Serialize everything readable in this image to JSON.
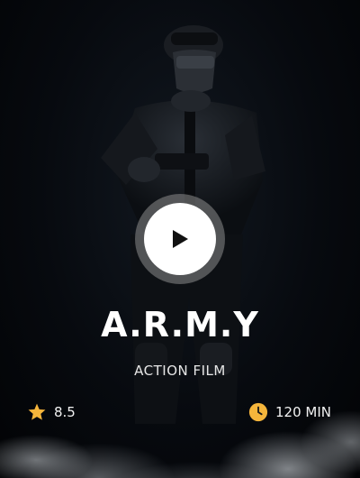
{
  "movie": {
    "title": "A.R.M.Y",
    "genre": "ACTION FILM",
    "rating": "8.5",
    "duration": "120 MIN"
  },
  "icons": {
    "rating": "star-icon",
    "duration": "clock-icon",
    "play": "play-icon"
  },
  "colors": {
    "accent": "#f5b53b",
    "background": "#05080c",
    "text": "#ffffff"
  }
}
